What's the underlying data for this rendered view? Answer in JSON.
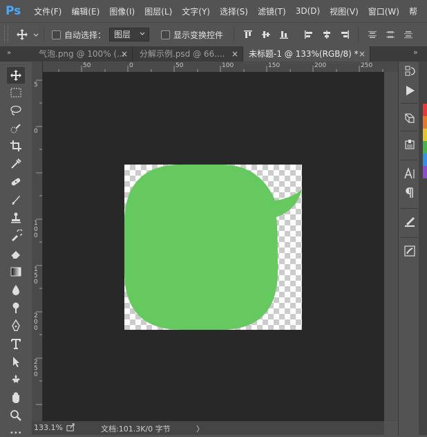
{
  "app": {
    "logo": "Ps",
    "menu": [
      "文件(F)",
      "编辑(E)",
      "图像(I)",
      "图层(L)",
      "文字(Y)",
      "选择(S)",
      "滤镜(T)",
      "3D(D)",
      "视图(V)",
      "窗口(W)",
      "帮"
    ]
  },
  "options": {
    "auto_select_label": "自动选择：",
    "auto_select_target": "图层",
    "show_transform_label": "显示变换控件"
  },
  "tabs": [
    {
      "label": "气泡.png @ 100% (...",
      "close": "×"
    },
    {
      "label": "分解示例.psd @ 66....",
      "close": "×"
    },
    {
      "label": "未标题-1 @ 133%(RGB/8) *",
      "close": "×"
    }
  ],
  "ruler": {
    "h_labels": [
      "50",
      "0",
      "50",
      "100",
      "150",
      "200",
      "250"
    ],
    "v_labels": [
      "5",
      "0",
      "1\n0\n0",
      "1\n5\n0",
      "2\n0\n0",
      "2\n5\n0"
    ]
  },
  "canvas": {
    "bubble_color": "#66c95f",
    "workspace_color": "#282828"
  },
  "status": {
    "zoom": "133.1%",
    "doc_info": "文档:101.3K/0 字节",
    "arrow": "〉"
  },
  "colors": {
    "ui_bg": "#535353",
    "tab_bg": "#3b3b3b",
    "accent_logo": "#4aa8ff",
    "swatch_strip": [
      "#e23b3b",
      "#e07a2e",
      "#e0c431",
      "#4bb04a",
      "#3a8fe0",
      "#8a4fc4"
    ]
  }
}
